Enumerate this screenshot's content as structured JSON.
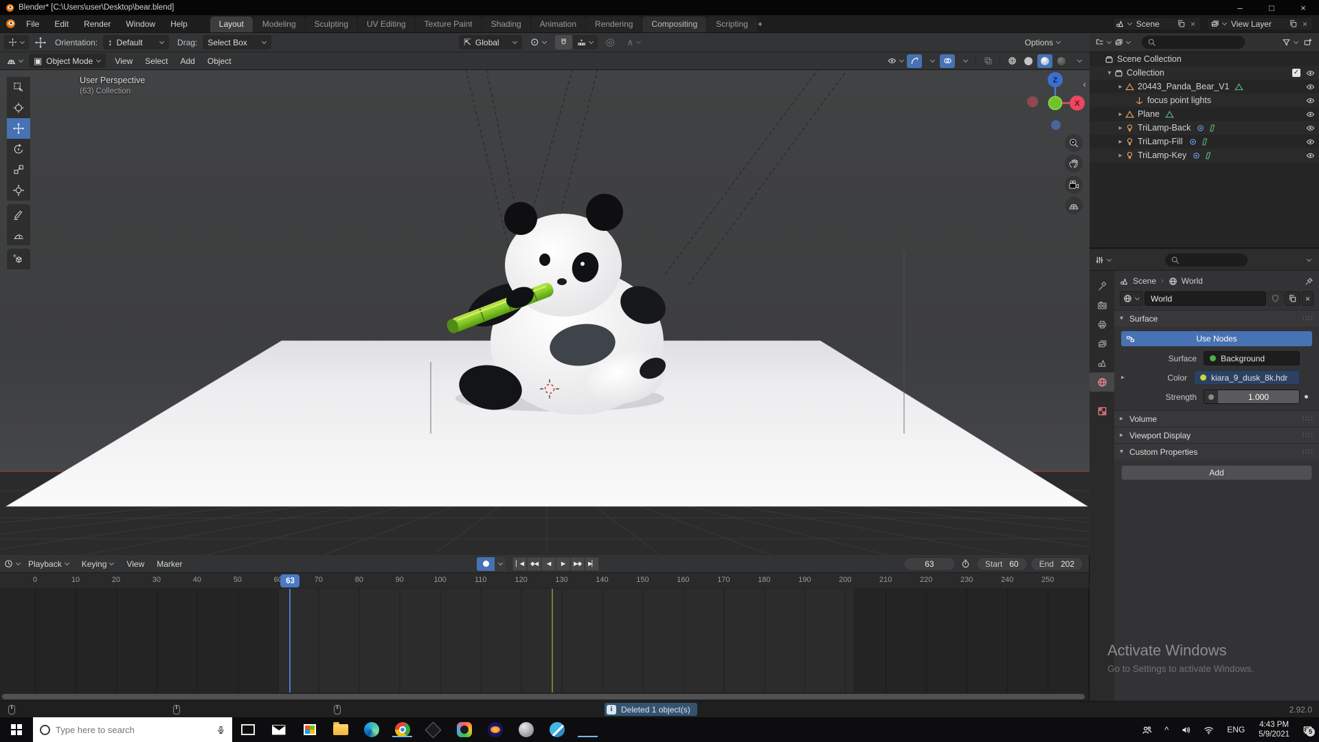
{
  "window": {
    "title": "Blender* [C:\\Users\\user\\Desktop\\bear.blend]",
    "controls": {
      "minimize": "–",
      "maximize": "□",
      "close": "×"
    }
  },
  "topbar": {
    "menus": [
      {
        "label": "File"
      },
      {
        "label": "Edit"
      },
      {
        "label": "Render"
      },
      {
        "label": "Window"
      },
      {
        "label": "Help"
      }
    ],
    "tabs": [
      {
        "label": "Layout",
        "active": true
      },
      {
        "label": "Modeling"
      },
      {
        "label": "Sculpting"
      },
      {
        "label": "UV Editing"
      },
      {
        "label": "Texture Paint"
      },
      {
        "label": "Shading"
      },
      {
        "label": "Animation"
      },
      {
        "label": "Rendering"
      },
      {
        "label": "Compositing",
        "hover": true
      },
      {
        "label": "Scripting"
      }
    ],
    "new_tab": "+",
    "scene": {
      "label": "Scene"
    },
    "view_layer": {
      "label": "View Layer"
    }
  },
  "tool_header": {
    "orientation_label": "Orientation:",
    "orientation_value": "Default",
    "drag_label": "Drag:",
    "drag_value": "Select Box",
    "transform_space": "Global",
    "options_label": "Options"
  },
  "viewport": {
    "header": {
      "mode": "Object Mode",
      "menus": [
        {
          "label": "View"
        },
        {
          "label": "Select"
        },
        {
          "label": "Add"
        },
        {
          "label": "Object"
        }
      ]
    },
    "tools": [
      {
        "ref": "#i-sel",
        "name": "tool-select-box"
      },
      {
        "ref": "#i-cur",
        "name": "tool-3d-cursor"
      },
      {
        "ref": "#i-move",
        "name": "tool-move",
        "active": true
      },
      {
        "ref": "#i-rot",
        "name": "tool-rotate"
      },
      {
        "ref": "#i-scale",
        "name": "tool-scale"
      },
      {
        "ref": "#i-xform",
        "name": "tool-transform"
      },
      {
        "ref": "#i-pencil",
        "name": "tool-annotate",
        "gap": true
      },
      {
        "ref": "#i-measure",
        "name": "tool-measure"
      },
      {
        "ref": "#i-addcube",
        "name": "tool-add-cube",
        "gap": true
      }
    ],
    "overlay": {
      "line1": "User Perspective",
      "line2": "(63) Collection"
    },
    "gizmo": {
      "x": "X",
      "z": "Z"
    }
  },
  "outliner": {
    "rows": [
      {
        "pad": "8px",
        "icon": "#i-coll",
        "ic": "c-wh",
        "label": "Scene Collection"
      },
      {
        "pad": "22px",
        "exp": "▾",
        "icon": "#i-coll",
        "ic": "c-wh",
        "label": "Collection",
        "check": "✓",
        "eye": true
      },
      {
        "pad": "38px",
        "exp": "▸",
        "icon": "#i-mesh16",
        "ic": "c-or",
        "label": "20443_Panda_Bear_V1",
        "d1": "#i-mesh16",
        "d1c": "c-gr",
        "eye": true
      },
      {
        "pad": "52px",
        "icon": "#i-axes16",
        "ic": "c-or",
        "label": "focus point lights",
        "eye": true
      },
      {
        "pad": "38px",
        "exp": "▸",
        "icon": "#i-mesh16",
        "ic": "c-or",
        "label": "Plane",
        "d1": "#i-mesh16",
        "d1c": "c-gr",
        "eye": true
      },
      {
        "pad": "38px",
        "exp": "▸",
        "icon": "#i-bulb16",
        "ic": "c-or",
        "label": "TriLamp-Back",
        "d1": "#i-spot16",
        "d1c": "c-bl",
        "d2": "#i-para16",
        "eye": true
      },
      {
        "pad": "38px",
        "exp": "▸",
        "icon": "#i-bulb16",
        "ic": "c-or",
        "label": "TriLamp-Fill",
        "d1": "#i-spot16",
        "d1c": "c-bl",
        "d2": "#i-para16",
        "eye": true
      },
      {
        "pad": "38px",
        "exp": "▸",
        "icon": "#i-bulb16",
        "ic": "c-or",
        "label": "TriLamp-Key",
        "d1": "#i-spot16",
        "d1c": "c-bl",
        "d2": "#i-para16",
        "eye": true
      }
    ]
  },
  "properties": {
    "tabs": [
      {
        "ref": "#i-tool16",
        "name": "properties-tab-tool"
      },
      {
        "ref": "#i-cam16",
        "name": "properties-tab-render"
      },
      {
        "ref": "#i-printer16",
        "name": "properties-tab-output"
      },
      {
        "ref": "#i-imgstack",
        "name": "properties-tab-view-layer"
      },
      {
        "ref": "#i-scene16",
        "name": "properties-tab-scene"
      },
      {
        "ref": "#i-world16",
        "name": "properties-tab-world",
        "active": true,
        "red": true
      },
      {
        "ref": "#i-tex16",
        "name": "properties-tab-texture",
        "red": true,
        "gap": true
      }
    ],
    "breadcrumb": {
      "scene": "Scene",
      "world": "World"
    },
    "datablock": {
      "name": "World"
    },
    "surface": {
      "title": "Surface",
      "use_nodes": "Use Nodes",
      "surface_label": "Surface",
      "surface_value": "Background",
      "color_label": "Color",
      "color_value": "kiara_9_dusk_8k.hdr",
      "strength_label": "Strength",
      "strength_value": "1.000"
    },
    "panels": [
      {
        "arrow": "▸",
        "title": "Volume"
      },
      {
        "arrow": "▸",
        "title": "Viewport Display"
      },
      {
        "arrow": "▾",
        "title": "Custom Properties"
      }
    ],
    "add_button": "Add"
  },
  "timeline": {
    "menus": [
      {
        "label": "Playback",
        "chev": true
      },
      {
        "label": "Keying",
        "chev": true
      },
      {
        "label": "View"
      },
      {
        "label": "Marker"
      }
    ],
    "transport": [
      {
        "g": "▏◀",
        "name": "jump-to-start-button"
      },
      {
        "g": "◆◀",
        "name": "previous-keyframe-button"
      },
      {
        "g": "◀",
        "name": "play-reverse-button"
      },
      {
        "g": "▶",
        "name": "play-button"
      },
      {
        "g": "▶◆",
        "name": "next-keyframe-button"
      },
      {
        "g": "▶▏",
        "name": "jump-to-end-button"
      }
    ],
    "current_frame": "63",
    "start_label": "Start",
    "start_value": "60",
    "end_label": "End",
    "end_value": "202",
    "ruler": [
      0,
      10,
      20,
      30,
      40,
      50,
      60,
      70,
      80,
      90,
      100,
      110,
      120,
      130,
      140,
      150,
      160,
      170,
      180,
      190,
      200,
      210,
      220,
      230,
      240,
      250
    ],
    "marker_frame": 127.5
  },
  "status_bar": {
    "message": "Deleted 1 object(s)",
    "version": "2.92.0"
  },
  "watermark": {
    "line1": "Activate Windows",
    "line2": "Go to Settings to activate Windows."
  },
  "taskbar": {
    "search_placeholder": "Type here to search",
    "apps": [
      {
        "name": "task-view"
      },
      {
        "name": "mail"
      },
      {
        "name": "store"
      },
      {
        "name": "explorer"
      },
      {
        "name": "edge"
      },
      {
        "name": "chrome",
        "open": true
      },
      {
        "name": "inkscape"
      },
      {
        "name": "resolve"
      },
      {
        "name": "audacity"
      },
      {
        "name": "gimp"
      },
      {
        "name": "krita"
      },
      {
        "name": "blender",
        "open": true
      }
    ],
    "tray": {
      "lang": "ENG",
      "time": "4:43 PM",
      "date": "5/9/2021",
      "badge": "5"
    }
  },
  "colors": {
    "accent": "#4772b3",
    "playhead": "#4b79c4",
    "bamboo": "#7cc832",
    "mesh_orange": "#e8a15c",
    "data_green": "#55b97a",
    "light_blue": "#6f9fe8"
  }
}
